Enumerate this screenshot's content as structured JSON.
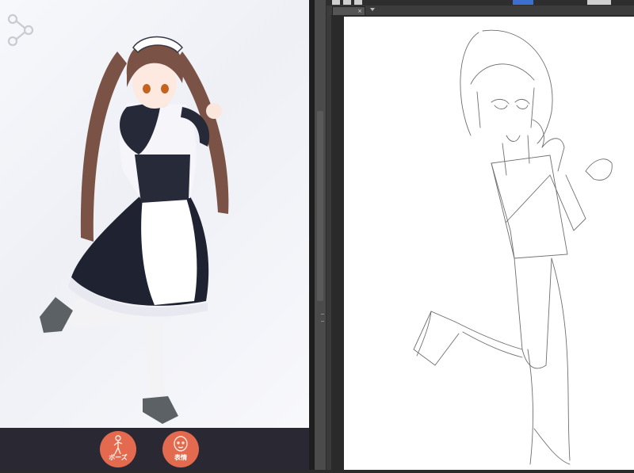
{
  "viewer": {
    "bottom_bar": {
      "pose_button": {
        "label": "ポーズ",
        "icon": "pose-figure-icon"
      },
      "expression_button": {
        "label": "表情",
        "icon": "face-icon"
      }
    },
    "share_icon": "share-icon",
    "accent_color": "#e36a4e",
    "bar_color": "#2a2833"
  },
  "editor": {
    "doc_tab": {
      "close_glyph": "×"
    },
    "panel_color": "#3a3a3a",
    "paper_color": "#ffffff"
  }
}
